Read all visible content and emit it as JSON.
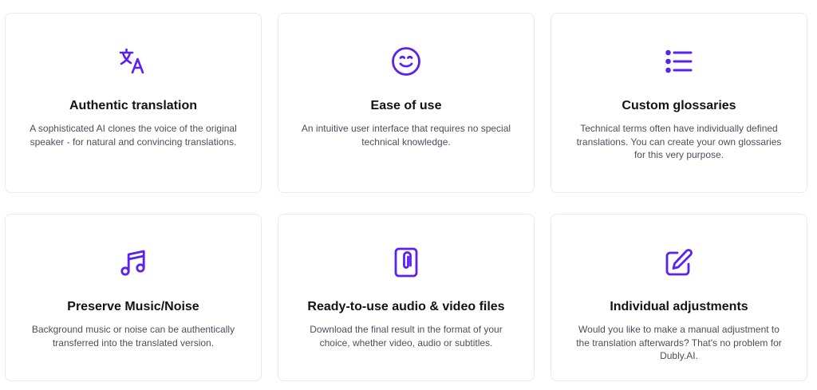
{
  "accent_color": "#5b21f0",
  "cards": [
    {
      "icon": "translate-icon",
      "title": "Authentic translation",
      "description": "A sophisticated AI clones the voice of the original speaker - for natural and convincing translations."
    },
    {
      "icon": "smiley-face-icon",
      "title": "Ease of use",
      "description": "An intuitive user interface that requires no special technical knowledge."
    },
    {
      "icon": "list-icon",
      "title": "Custom glossaries",
      "description": "Technical terms often have individually defined translations. You can create your own glossaries for this very purpose."
    },
    {
      "icon": "music-note-icon",
      "title": "Preserve Music/Noise",
      "description": "Background music or noise can be authentically transferred into the translated version."
    },
    {
      "icon": "paperclip-file-icon",
      "title": "Ready-to-use audio & video files",
      "description": "Download the final result in the format of your choice, whether video, audio or subtitles."
    },
    {
      "icon": "edit-pencil-icon",
      "title": "Individual adjustments",
      "description": "Would you like to make a manual adjustment to the translation afterwards? That's no problem for Dubly.AI."
    }
  ]
}
